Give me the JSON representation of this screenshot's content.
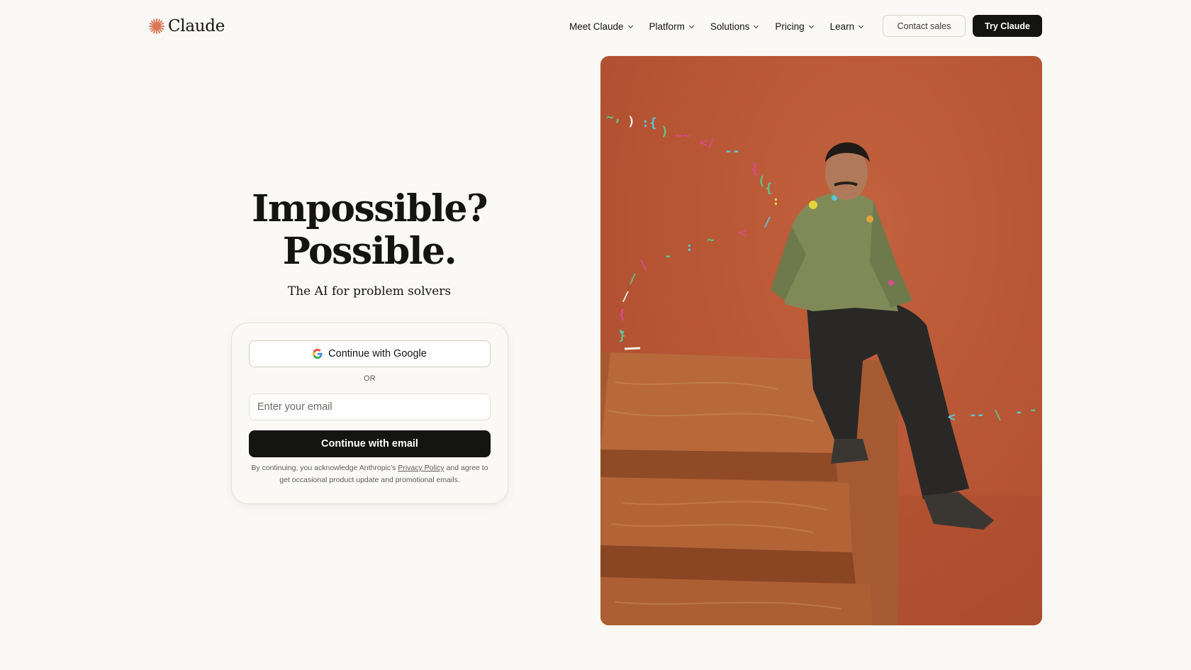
{
  "header": {
    "logo_text": "Claude",
    "nav": [
      {
        "label": "Meet Claude"
      },
      {
        "label": "Platform"
      },
      {
        "label": "Solutions"
      },
      {
        "label": "Pricing"
      },
      {
        "label": "Learn"
      }
    ],
    "contact_label": "Contact sales",
    "try_label": "Try Claude"
  },
  "hero": {
    "title_line1": "Impossible?",
    "title_line2": "Possible.",
    "subtitle": "The AI for problem solvers"
  },
  "signup": {
    "google_label": "Continue with Google",
    "or_label": "OR",
    "email_placeholder": "Enter your email",
    "email_button": "Continue with email",
    "disclaimer_pre": "By continuing, you acknowledge Anthropic's ",
    "policy_link": "Privacy Policy",
    "disclaimer_post": " and agree to get occasional product update and promotional emails."
  },
  "colors": {
    "brand_accent": "#d97757",
    "background": "#faf9f5",
    "primary_button": "#141413",
    "hero_image_bg": "#b55433"
  }
}
